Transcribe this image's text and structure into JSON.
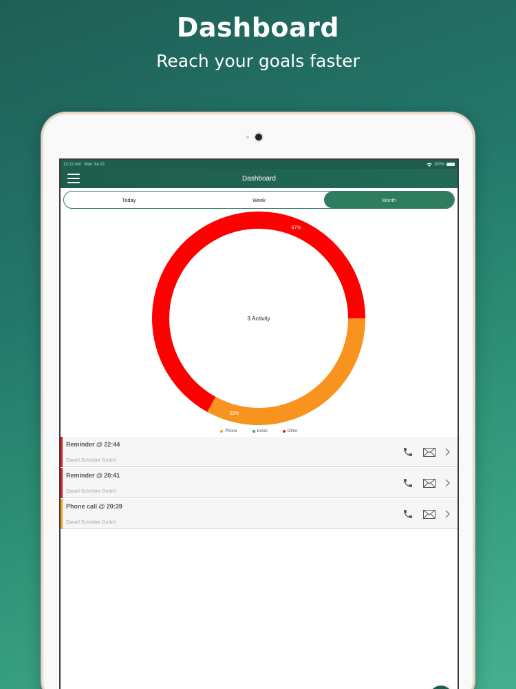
{
  "hero": {
    "title": "Dashboard",
    "subtitle": "Reach your goals faster"
  },
  "status_bar": {
    "time_date": "12:12 AM · Mon Jul 22",
    "battery": "100%"
  },
  "nav": {
    "title": "Dashboard",
    "menu_icon": "hamburger-icon"
  },
  "tabs": [
    {
      "label": "Today",
      "active": false
    },
    {
      "label": "Week",
      "active": false
    },
    {
      "label": "Month",
      "active": true
    }
  ],
  "chart_data": {
    "type": "pie",
    "center_label": "3 Activity",
    "slices": [
      {
        "label": "Other",
        "value": 67,
        "display": "67%",
        "color": "#ff0000"
      },
      {
        "label": "Phone",
        "value": 33,
        "display": "33%",
        "color": "#f7931e"
      }
    ],
    "legend": [
      {
        "label": "Phone",
        "color": "#f7a21b"
      },
      {
        "label": "Email",
        "color": "#2aa87a"
      },
      {
        "label": "Other",
        "color": "#e02020"
      }
    ]
  },
  "activities": [
    {
      "title": "Reminder @ 22:44",
      "company": "Daniel Schröder GmbH",
      "marker_color": "#e02020"
    },
    {
      "title": "Reminder @ 20:41",
      "company": "Daniel Schröder GmbH",
      "marker_color": "#e02020"
    },
    {
      "title": "Phone call @ 20:39",
      "company": "Daniel Schröder GmbH",
      "marker_color": "#f7a21b"
    }
  ],
  "fab": {
    "label": "+"
  },
  "colors": {
    "accent": "#2e7d60",
    "header": "#1e5c4c"
  }
}
